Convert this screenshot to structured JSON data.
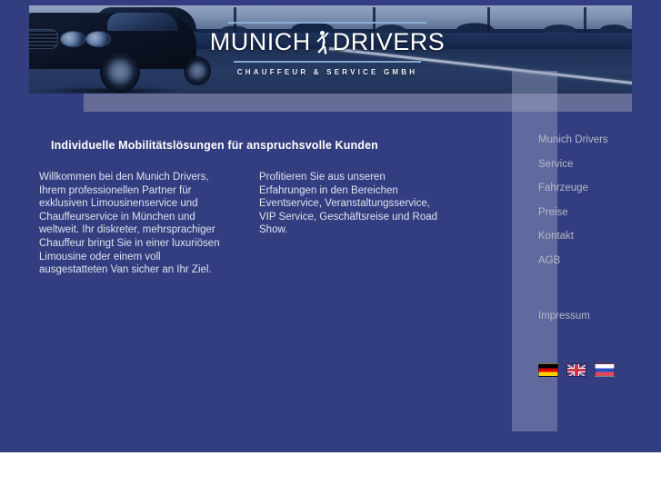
{
  "site": {
    "background_color": "#333e80",
    "panel_color": "#6b7099",
    "accent_color": "#8fb2d8"
  },
  "banner": {
    "logo_word_1": "MUNICH",
    "logo_word_2": "DRIVERS",
    "figure_icon": "walking-chauffeur-icon",
    "tagline": "CHAUFFEUR & SERVICE GMBH",
    "photo_description": "dark blue toned luxury sedan on a country road"
  },
  "main": {
    "heading": "Individuelle Mobilitätslösungen für anspruchsvolle Kunden",
    "column_left": "Willkommen bei den Munich Drivers, Ihrem professionellen Partner für exklusiven Limousinenservice und Chauffeurservice in München und weltweit. Ihr diskreter, mehrsprachiger Chauffeur bringt Sie in einer luxuriösen Limousine oder einem voll ausgestatteten Van sicher an Ihr Ziel.",
    "column_right": "Profitieren Sie aus unseren Erfahrungen in den Bereichen Eventservice, Veranstaltungsservice, VIP Service, Geschäftsreise und Road Show."
  },
  "nav": {
    "items": [
      {
        "label": "Munich Drivers"
      },
      {
        "label": "Service"
      },
      {
        "label": "Fahrzeuge"
      },
      {
        "label": "Preise"
      },
      {
        "label": "Kontakt"
      },
      {
        "label": "AGB"
      }
    ],
    "imprint": "Impressum"
  },
  "languages": [
    {
      "code": "de",
      "name": "german-flag"
    },
    {
      "code": "en",
      "name": "united-kingdom-flag"
    },
    {
      "code": "ru",
      "name": "russian-flag"
    }
  ]
}
